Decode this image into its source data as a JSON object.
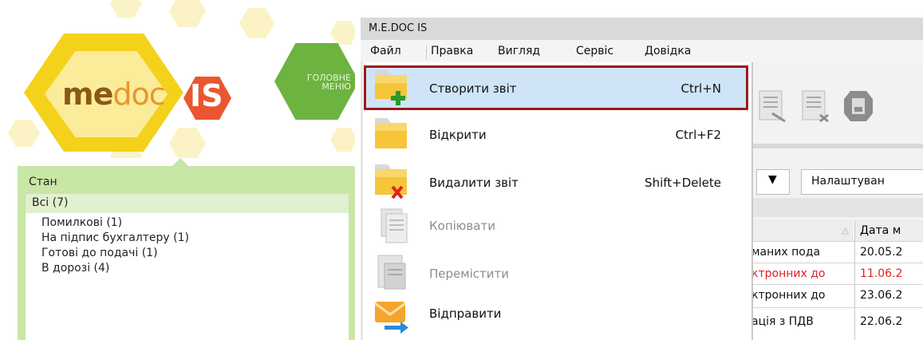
{
  "logo": {
    "part1": "me",
    "part2": "doc",
    "part3": "IS"
  },
  "main_menu_button": "ГОЛОВНЕ\nМЕНЮ",
  "state_panel": {
    "title": "Стан",
    "all": "Всі (7)",
    "items": [
      "Помилкові (1)",
      "На підпис бухгалтеру (1)",
      "Готові до подачі (1)",
      "В дорозі (4)"
    ]
  },
  "window": {
    "title": "M.E.DOC IS",
    "menu": [
      "Файл",
      "Правка",
      "Вигляд",
      "Сервіс",
      "Довідка"
    ]
  },
  "file_menu": [
    {
      "label": "Створити звіт",
      "shortcut": "Ctrl+N",
      "enabled": true,
      "icon": "folder-add-icon"
    },
    {
      "label": "Відкрити",
      "shortcut": "Ctrl+F2",
      "enabled": true,
      "icon": "folder-open-icon"
    },
    {
      "label": "Видалити звіт",
      "shortcut": "Shift+Delete",
      "enabled": true,
      "icon": "folder-delete-icon"
    },
    {
      "label": "Копіювати",
      "shortcut": "",
      "enabled": false,
      "icon": "copy-icon"
    },
    {
      "label": "Перемістити",
      "shortcut": "",
      "enabled": false,
      "icon": "move-icon"
    },
    {
      "label": "Відправити",
      "shortcut": "",
      "enabled": true,
      "icon": "send-envelope-icon"
    }
  ],
  "filter": {
    "settings_label": "Налаштуван"
  },
  "table": {
    "headers": [
      "",
      "Дата м"
    ],
    "rows": [
      {
        "name": "маних пода",
        "date": "20.05.2",
        "highlight": false
      },
      {
        "name": "ктронних до",
        "date": "11.06.2",
        "highlight": true
      },
      {
        "name": "ктронних до",
        "date": "23.06.2",
        "highlight": false
      },
      {
        "name": "ація з ПДВ",
        "date": "22.06.2",
        "highlight": false
      }
    ]
  },
  "colors": {
    "highlight_border": "#9b1b1b",
    "highlight_bg": "#cfe4f7",
    "panel_green": "#c8e6a6",
    "error_text": "#e02020"
  }
}
